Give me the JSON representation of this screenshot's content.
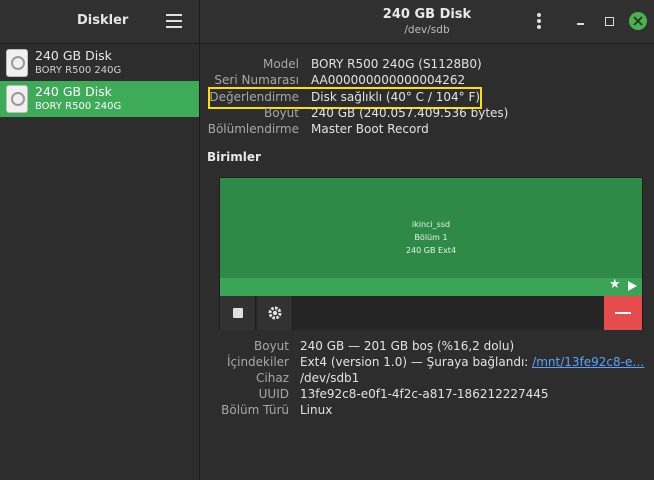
{
  "sidebar": {
    "title": "Diskler",
    "items": [
      {
        "name": "240 GB Disk",
        "model": "BORY R500 240G",
        "selected": false
      },
      {
        "name": "240 GB Disk",
        "model": "BORY R500 240G",
        "selected": true
      }
    ]
  },
  "header": {
    "title": "240 GB Disk",
    "subtitle": "/dev/sdb"
  },
  "disk_props": [
    {
      "label": "Model",
      "value": "BORY R500 240G (S1128B0)"
    },
    {
      "label": "Seri Numarası",
      "value": "AA000000000000004262"
    },
    {
      "label": "Değerlendirme",
      "value": "Disk sağlıklı (40° C / 104° F)"
    },
    {
      "label": "Boyut",
      "value": "240 GB (240.057.409.536 bytes)"
    },
    {
      "label": "Bölümlendirme",
      "value": "Master Boot Record"
    }
  ],
  "volumes": {
    "title": "Birimler",
    "partition": {
      "name": "ikinci_ssd",
      "number": "Bölüm 1",
      "size": "240 GB Ext4"
    }
  },
  "vol_props": [
    {
      "label": "Boyut",
      "value": "240 GB — 201 GB boş (%16,2 dolu)"
    },
    {
      "label": "İçindekiler",
      "value": "Ext4 (version 1.0) — Şuraya bağlandı: ",
      "link": "/mnt/13fe92c8-e…"
    },
    {
      "label": "Cihaz",
      "value": "/dev/sdb1"
    },
    {
      "label": "UUID",
      "value": "13fe92c8-e0f1-4f2c-a817-186212227445"
    },
    {
      "label": "Bölüm Türü",
      "value": "Linux"
    }
  ],
  "colors": {
    "selection": "#3eab59",
    "partition": "#2e8a46",
    "delete": "#e74c4c",
    "highlight": "#ffe000",
    "link": "#5aa0ff"
  }
}
